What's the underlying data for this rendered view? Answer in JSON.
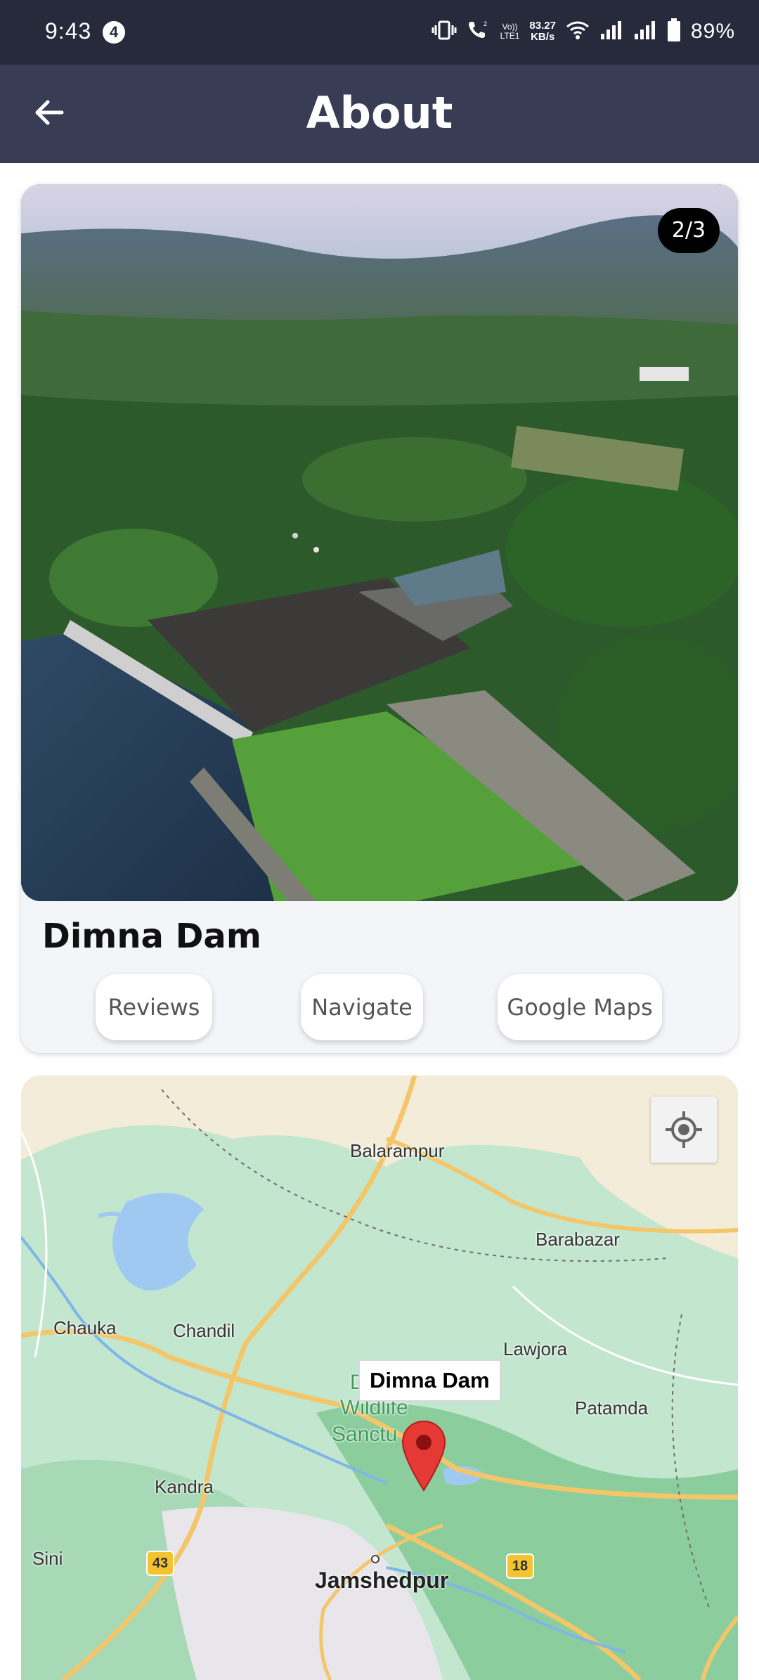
{
  "status_bar": {
    "time": "9:43",
    "notification_count": "4",
    "volte_line1": "Vo))",
    "volte_line2": "LTE1",
    "net_speed_value": "83.27",
    "net_speed_unit": "KB/s",
    "battery": "89%"
  },
  "app_bar": {
    "title": "About",
    "back_icon": "arrow-left-icon"
  },
  "place": {
    "image_counter": "2/3",
    "name": "Dimna Dam",
    "buttons": {
      "reviews": "Reviews",
      "navigate": "Navigate",
      "google_maps": "Google Maps"
    }
  },
  "map": {
    "marker_label": "Dimna Dam",
    "labels": {
      "balarampur": "Balarampur",
      "barabazar": "Barabazar",
      "chauka": "Chauka",
      "chandil": "Chandil",
      "lawjora": "Lawjora",
      "patamda": "Patamda",
      "wildlife_1": "D",
      "wildlife_2": "Wildlife",
      "wildlife_3": "Sanctu",
      "kandra": "Kandra",
      "sini": "Sini",
      "jamshedpur": "Jamshedpur"
    },
    "shields": {
      "nh43": "43",
      "nh18": "18"
    },
    "locate_icon": "my-location-icon"
  },
  "colors": {
    "status_bar_bg": "#262a3b",
    "app_bar_bg": "#383c55",
    "card_bg": "#f4f5f9",
    "map_green": "#bfe3cb",
    "marker_red": "#e53935"
  }
}
